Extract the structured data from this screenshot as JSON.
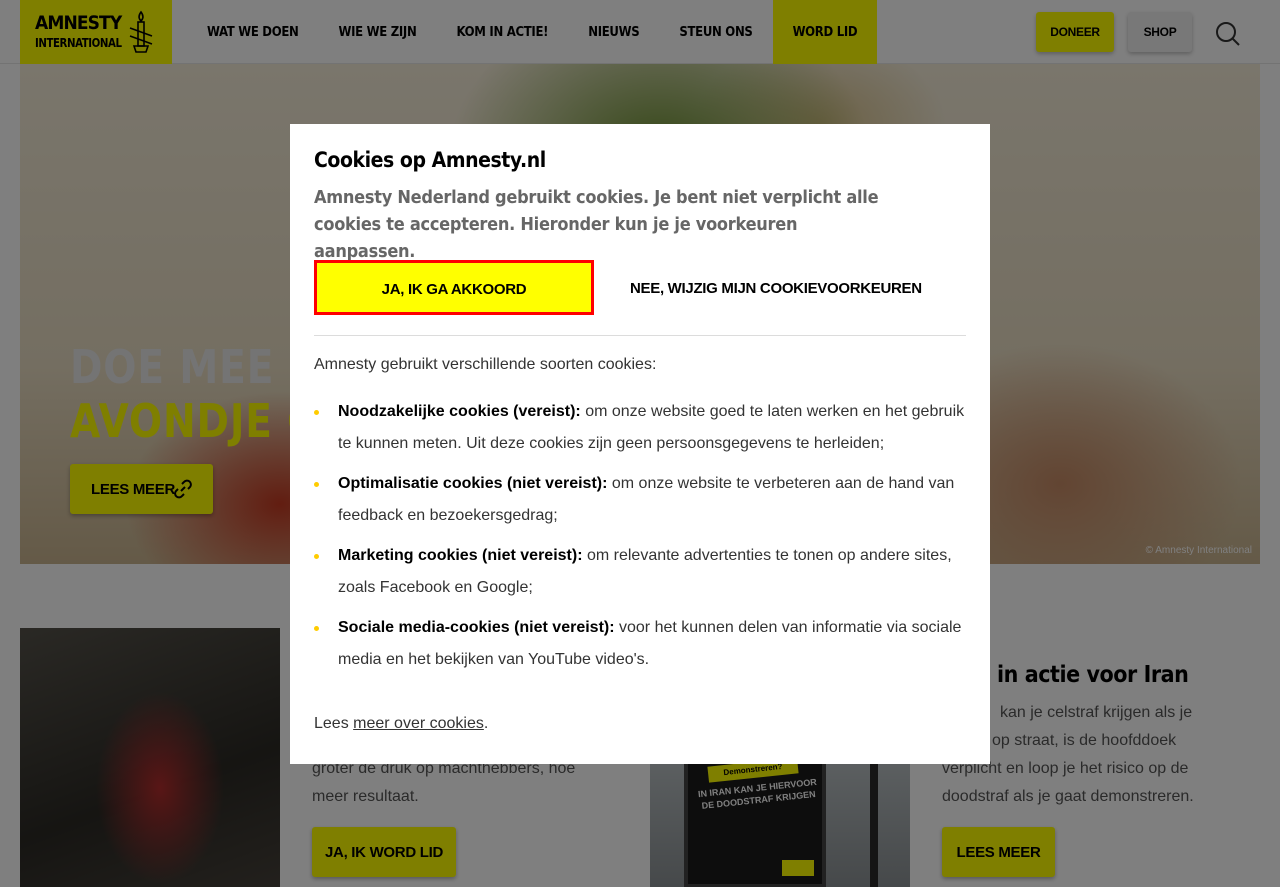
{
  "header": {
    "logo_line1": "AMNESTY",
    "logo_line2": "INTERNATIONAL",
    "nav": [
      {
        "label": "WAT WE DOEN"
      },
      {
        "label": "WIE WE ZIJN"
      },
      {
        "label": "KOM IN ACTIE!"
      },
      {
        "label": "NIEUWS"
      },
      {
        "label": "STEUN ONS"
      },
      {
        "label": "WORD LID"
      }
    ],
    "donate_label": "DONEER",
    "shop_label": "SHOP"
  },
  "hero": {
    "title_line1": "DOE MEE ME",
    "title_line2": "AVONDJE GE",
    "button_label": "LEES MEER",
    "credit": "© Amnesty International"
  },
  "cards": [
    {
      "text": "groter de druk op machthebbers, hoe meer resultaat.",
      "button_label": "JA, IK WORD LID"
    },
    {
      "title": "in actie voor Iran",
      "text_lines": [
        "kan je celstraf krijgen als je",
        "op straat, is de hoofddoek",
        "verplicht en loop je het risico op de",
        "doodstraf als je gaat demonstreren."
      ],
      "poster_tag": "Demonstreren?",
      "poster_text": "IN IRAN KAN JE HIERVOOR DE DOODSTRAF KRIJGEN",
      "button_label": "LEES MEER"
    }
  ],
  "cookie_modal": {
    "title": "Cookies op Amnesty.nl",
    "intro": "Amnesty Nederland gebruikt cookies. Je bent niet verplicht alle cookies te accepteren. Hieronder kun je je voorkeuren aanpassen.",
    "accept_label": "JA, IK GA AKKOORD",
    "decline_label": "NEE, WIJZIG MIJN COOKIEVOORKEUREN",
    "lead": "Amnesty gebruikt verschillende soorten cookies:",
    "items": [
      {
        "label": "Noodzakelijke cookies (vereist):",
        "text": " om onze website goed te laten werken en het gebruik te kunnen meten. Uit deze cookies zijn geen persoonsgegevens te herleiden;"
      },
      {
        "label": "Optimalisatie cookies (niet vereist):",
        "text": " om onze website te verbeteren aan de hand van feedback en bezoekersgedrag;"
      },
      {
        "label": "Marketing cookies (niet vereist):",
        "text": " om relevante advertenties te tonen op andere sites, zoals Facebook en Google;"
      },
      {
        "label": "Sociale media-cookies (niet vereist):",
        "text": " voor het kunnen delen van informatie via sociale media en het bekijken van YouTube video's."
      }
    ],
    "foot_prefix": "Lees ",
    "foot_link": "meer over cookies",
    "foot_suffix": "."
  },
  "colors": {
    "accent": "#ffff00",
    "focus_outline": "#ff0000",
    "bullet": "#ffcc00"
  }
}
